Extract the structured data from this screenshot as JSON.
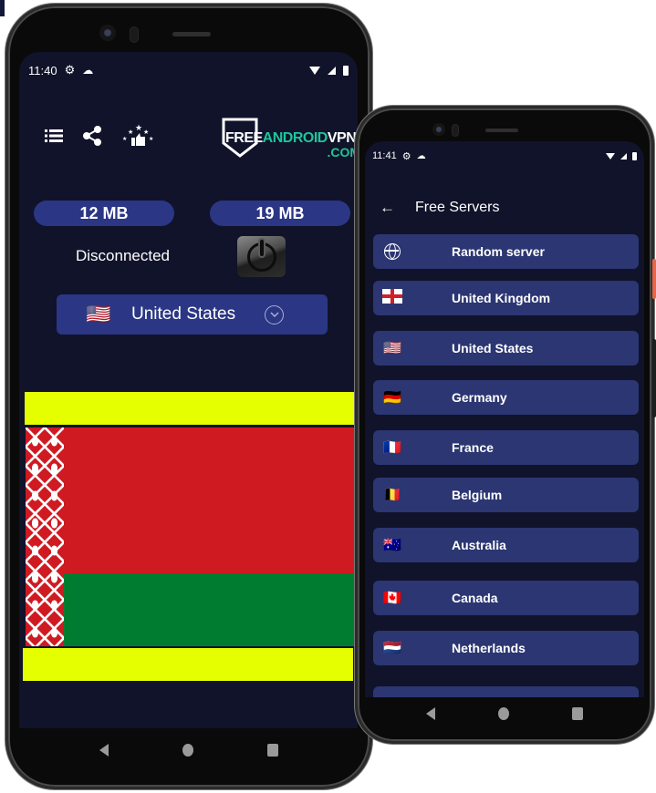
{
  "left_phone": {
    "status_bar": {
      "time": "11:40",
      "icons": [
        "gear-icon",
        "cloud-icon",
        "wifi-icon",
        "signal-icon",
        "battery-icon"
      ]
    },
    "toolbar": {
      "menu_icon": "☰",
      "share_icon": "⋖",
      "rate_icon": "★👍"
    },
    "logo": {
      "free": "FREE",
      "android": "ANDROID",
      "vpn": "VPN",
      "com": ".COM"
    },
    "stats": {
      "download": "12 MB",
      "upload": "19 MB"
    },
    "connection_status": "Disconnected",
    "country_selector": {
      "flag": "🇺🇸",
      "name": "United States",
      "chevron": "⌄"
    },
    "banner": {
      "description": "Belarus flag advertisement banner",
      "colors": {
        "yellow": "#e6ff00",
        "red": "#cf1a22",
        "green": "#007c30"
      }
    }
  },
  "right_phone": {
    "status_bar": {
      "time": "11:41"
    },
    "appbar": {
      "back": "←",
      "title": "Free Servers"
    },
    "servers": [
      {
        "flag": "globe",
        "name": "Random server"
      },
      {
        "flag": "🏴",
        "name": "United Kingdom"
      },
      {
        "flag": "🇺🇸",
        "name": "United States"
      },
      {
        "flag": "🇩🇪",
        "name": "Germany"
      },
      {
        "flag": "🇫🇷",
        "name": "France"
      },
      {
        "flag": "🇧🇪",
        "name": "Belgium"
      },
      {
        "flag": "🇦🇺",
        "name": "Australia"
      },
      {
        "flag": "🇨🇦",
        "name": "Canada"
      },
      {
        "flag": "🇳🇱",
        "name": "Netherlands"
      },
      {
        "flag": "",
        "name": ""
      }
    ]
  },
  "theme": {
    "background": "#10132a",
    "accent": "#2b3784",
    "list_item": "#2b3672",
    "logo_green": "#1ec59a"
  }
}
